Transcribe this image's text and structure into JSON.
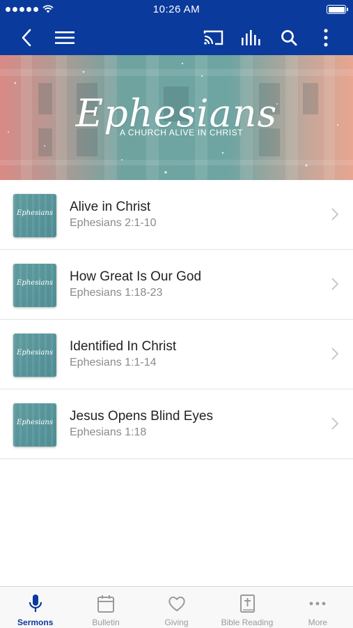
{
  "status_bar": {
    "time": "10:26 AM",
    "signal_icon": "signal-dots-icon",
    "wifi_icon": "wifi-icon",
    "battery_icon": "battery-icon"
  },
  "nav_bar": {
    "back_icon": "back-chevron-icon",
    "menu_icon": "hamburger-menu-icon",
    "cast_icon": "cast-icon",
    "audio_icon": "audio-levels-icon",
    "search_icon": "search-icon",
    "more_icon": "more-vertical-icon",
    "color": "#0a3a9c"
  },
  "hero": {
    "title": "Ephesians",
    "subtitle": "A CHURCH ALIVE IN CHRIST"
  },
  "sermons": [
    {
      "title": "Alive in Christ",
      "reference": "Ephesians 2:1-10",
      "thumb_text": "Ephesians"
    },
    {
      "title": "How Great Is Our God",
      "reference": "Ephesians 1:18-23",
      "thumb_text": "Ephesians"
    },
    {
      "title": "Identified In Christ",
      "reference": "Ephesians 1:1-14",
      "thumb_text": "Ephesians"
    },
    {
      "title": "Jesus Opens Blind Eyes",
      "reference": "Ephesians 1:18",
      "thumb_text": "Ephesians"
    }
  ],
  "tabs": [
    {
      "label": "Sermons",
      "icon": "microphone-icon",
      "active": true
    },
    {
      "label": "Bulletin",
      "icon": "calendar-icon",
      "active": false
    },
    {
      "label": "Giving",
      "icon": "heart-icon",
      "active": false
    },
    {
      "label": "Bible Reading",
      "icon": "bible-icon",
      "active": false
    },
    {
      "label": "More",
      "icon": "more-horizontal-icon",
      "active": false
    }
  ],
  "colors": {
    "accent": "#0a3a9c",
    "tab_inactive": "#9a9a9a"
  }
}
